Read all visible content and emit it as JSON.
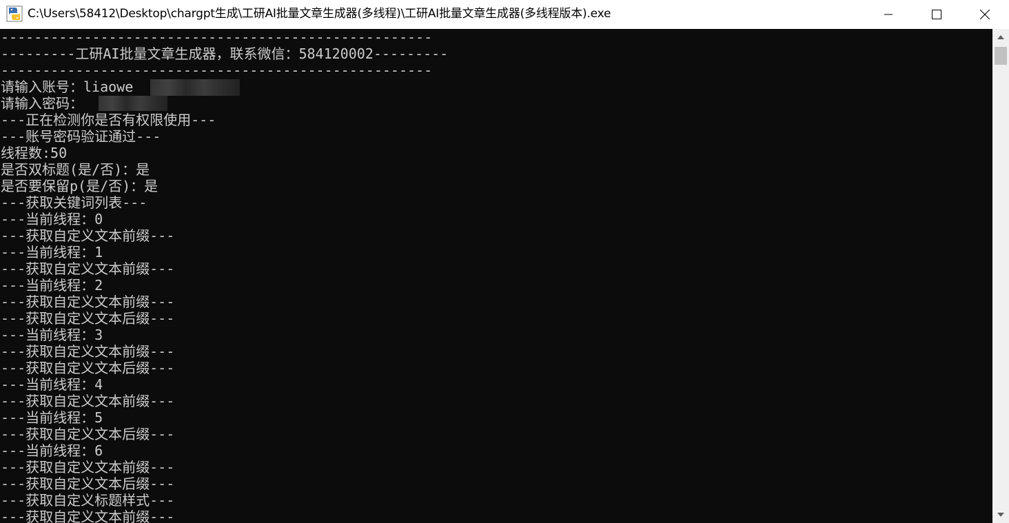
{
  "window": {
    "title": "C:\\Users\\58412\\Desktop\\chargpt生成\\工研AI批量文章生成器(多线程)\\工研AI批量文章生成器(多线程版本).exe",
    "icon": "python-app-icon",
    "controls": {
      "minimize": "minimize-icon",
      "maximize": "maximize-icon",
      "close": "close-icon"
    }
  },
  "console": {
    "lines": [
      "----------------------------------------------------",
      "---------工研AI批量文章生成器，联系微信：584120002---------",
      "----------------------------------------------------",
      "请输入账号：liaowe",
      "请输入密码：",
      "---正在检测你是否有权限使用---",
      "---账号密码验证通过---",
      "线程数:50",
      "是否双标题(是/否)：是",
      "是否要保留p(是/否)：是",
      "---获取关键词列表---",
      "---当前线程：0",
      "---获取自定义文本前缀---",
      "---当前线程：1",
      "---获取自定义文本前缀---",
      "---当前线程：2",
      "---获取自定义文本前缀---",
      "---获取自定义文本后缀---",
      "---当前线程：3",
      "---获取自定义文本前缀---",
      "---获取自定义文本后缀---",
      "---当前线程：4",
      "---获取自定义文本前缀---",
      "---当前线程：5",
      "---获取自定义文本后缀---",
      "---当前线程：6",
      "---获取自定义文本前缀---",
      "---获取自定义文本后缀---",
      "---获取自定义标题样式---",
      "---获取自定义文本前缀---"
    ]
  },
  "colors": {
    "console_bg": "#0c0c0c",
    "console_text": "#cccccc",
    "titlebar_bg": "#ffffff",
    "scrollbar_bg": "#f0f0f0",
    "scrollbar_thumb": "#c1c1c1"
  }
}
